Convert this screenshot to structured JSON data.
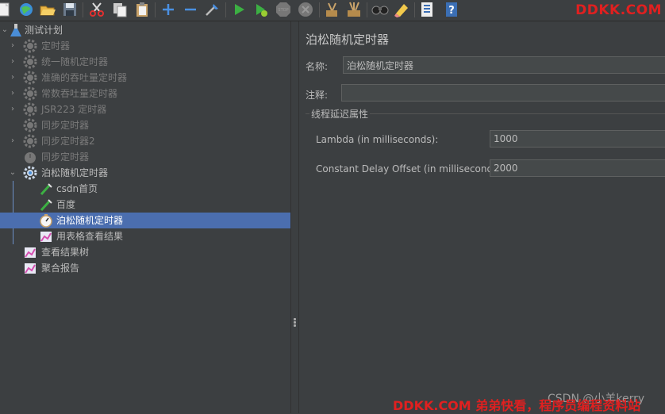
{
  "toolbar": {
    "buttons": [
      "new-icon",
      "templates-icon",
      "open-icon",
      "save-icon",
      "cut-icon",
      "copy-icon",
      "paste-icon",
      "expand-icon",
      "collapse-icon",
      "toggle-icon",
      "start-icon",
      "start-no-pause-icon",
      "stop-icon",
      "shutdown-icon",
      "clear-icon",
      "clear-all-icon",
      "search-icon",
      "reset-search-icon",
      "function-helper-icon",
      "help-icon"
    ],
    "watermark": "DDKK.COM"
  },
  "tree": {
    "root": "测试计划",
    "items": [
      {
        "label": "定时器",
        "icon": "gear-icon",
        "disabled": true
      },
      {
        "label": "统一随机定时器",
        "icon": "gear-icon",
        "disabled": true
      },
      {
        "label": "准确的吞吐量定时器",
        "icon": "gear-icon",
        "disabled": true
      },
      {
        "label": "常数吞吐量定时器",
        "icon": "gear-icon",
        "disabled": true
      },
      {
        "label": "JSR223 定时器",
        "icon": "gear-icon",
        "disabled": true
      },
      {
        "label": "同步定时器",
        "icon": "gear-icon",
        "disabled": true
      },
      {
        "label": "同步定时器2",
        "icon": "gear-icon",
        "disabled": true
      },
      {
        "label": "同步定时器",
        "icon": "timer-icon",
        "disabled": true
      },
      {
        "label": "泊松随机定时器",
        "icon": "gear-icon",
        "disabled": false
      },
      {
        "label": "csdn首页",
        "icon": "sampler-icon",
        "disabled": false
      },
      {
        "label": "百度",
        "icon": "sampler-icon",
        "disabled": false
      },
      {
        "label": "泊松随机定时器",
        "icon": "timer-icon",
        "disabled": false
      },
      {
        "label": "用表格查看结果",
        "icon": "listener-icon",
        "disabled": false
      },
      {
        "label": "查看结果树",
        "icon": "listener-icon",
        "disabled": false
      },
      {
        "label": "聚合报告",
        "icon": "listener-icon",
        "disabled": false
      }
    ]
  },
  "panel": {
    "title": "泊松随机定时器",
    "name_label": "名称:",
    "name_value": "泊松随机定时器",
    "comment_label": "注释:",
    "comment_value": "",
    "group_title": "线程延迟属性",
    "lambda_label": "Lambda (in milliseconds):",
    "lambda_value": "1000",
    "offset_label": "Constant Delay Offset (in milliseconds):",
    "offset_value": "2000"
  },
  "watermark_bottom": "DDKK.COM 弟弟快看，程序员编程资料站",
  "csdn_watermark": "CSDN @小羊kerry",
  "colors": {
    "selection": "#4b6eaf",
    "watermark": "#e02020",
    "background": "#3c3f41"
  }
}
